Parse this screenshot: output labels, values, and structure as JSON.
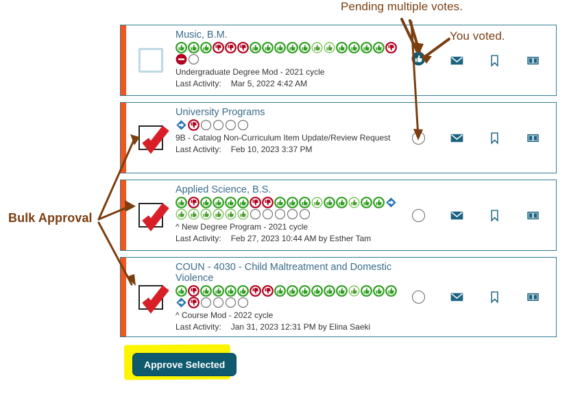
{
  "annotations": {
    "pending": "Pending multiple votes.",
    "voted": "You voted.",
    "bulk": "Bulk Approval"
  },
  "colors": {
    "accent_bar": "#f4541d",
    "card_border": "#2e7b94",
    "title": "#3a6c8c",
    "annotation": "#7a3e10",
    "button_bg": "#0f5a6e",
    "highlight": "#fdf500",
    "vote_up": "#2f9e1f",
    "vote_down": "#b1001e",
    "vote_skip": "#1f6fb2",
    "vote_empty": "#ffffff"
  },
  "button": {
    "approve_label": "Approve Selected"
  },
  "icon_names": {
    "vote_up": "thumbs-up-icon",
    "vote_up_light": "thumbs-up-light-icon",
    "vote_down": "thumbs-down-icon",
    "vote_block": "no-entry-icon",
    "vote_skip": "diamond-forward-icon",
    "vote_pending": "empty-circle-icon",
    "voted": "voted-badge-icon",
    "message": "envelope-icon",
    "bookmark": "bookmark-icon",
    "compare": "compare-columns-icon"
  },
  "items": [
    {
      "checkbox": "empty",
      "title": "Music, B.M.",
      "subtitle": "Undergraduate Degree Mod - 2021 cycle",
      "activity_label": "Last Activity:",
      "activity_value": "Mar 5, 2022 4:42 AM",
      "vote_status": "voted",
      "votes": [
        "up",
        "up",
        "up",
        "down",
        "down",
        "down",
        "up",
        "up",
        "up",
        "up",
        "up",
        "up-light",
        "up-light",
        "up",
        "up",
        "up",
        "up",
        "down",
        "block",
        "empty"
      ]
    },
    {
      "checkbox": "checked",
      "title": "University Programs",
      "subtitle": "9B - Catalog Non-Curriculum Item Update/Review Request",
      "activity_label": "Last Activity:",
      "activity_value": "Feb 10, 2023 3:37 PM",
      "vote_status": "pending",
      "votes": [
        "skip",
        "down",
        "empty",
        "empty",
        "empty",
        "empty"
      ]
    },
    {
      "checkbox": "checked",
      "title": "Applied Science, B.S.",
      "subtitle": "^ New Degree Program - 2021 cycle",
      "activity_label": "Last Activity:",
      "activity_value": "Feb 27, 2023 10:44 AM by Esther Tam",
      "vote_status": "pending",
      "votes": [
        "up",
        "down",
        "up",
        "up",
        "up",
        "up",
        "down",
        "down",
        "up",
        "up",
        "up",
        "up-light",
        "up",
        "up",
        "up-light",
        "up",
        "up",
        "skip",
        "up-light",
        "up-light",
        "up-light",
        "up-light",
        "up-light",
        "up-light",
        "empty",
        "empty",
        "empty",
        "empty",
        "empty"
      ]
    },
    {
      "checkbox": "checked",
      "title": "COUN - 4030 - Child Maltreatment and Domestic Violence",
      "subtitle": "^ Course Mod - 2022 cycle",
      "activity_label": "Last Activity:",
      "activity_value": "Jan 31, 2023 12:31 PM by Elina Saeki",
      "vote_status": "pending",
      "votes": [
        "up",
        "down",
        "up",
        "up",
        "up",
        "up",
        "down",
        "down",
        "up",
        "up",
        "up",
        "up",
        "up",
        "up",
        "up-light",
        "up",
        "up",
        "up",
        "skip",
        "down",
        "empty",
        "empty",
        "empty",
        "empty"
      ]
    }
  ]
}
